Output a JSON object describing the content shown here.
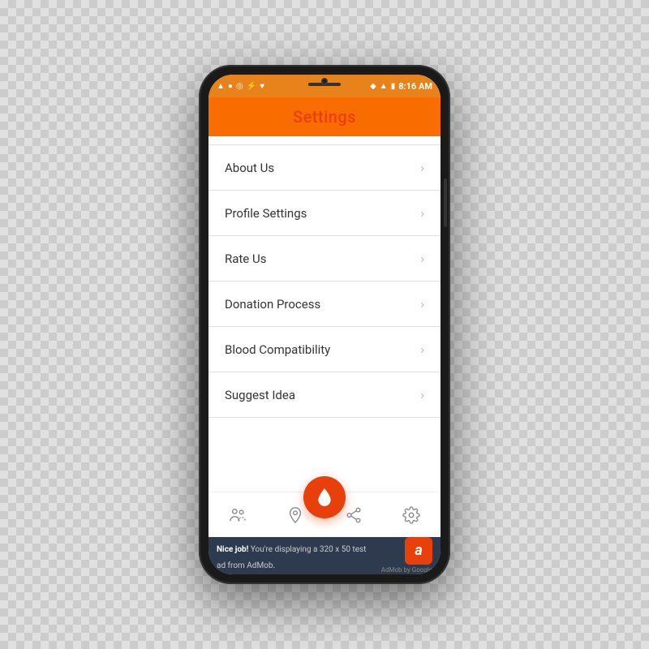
{
  "phone": {
    "status_bar": {
      "time": "8:16 AM",
      "battery": "81%"
    },
    "header": {
      "title": "Settings"
    },
    "menu": {
      "items": [
        {
          "id": "about-us",
          "label": "About Us"
        },
        {
          "id": "profile-settings",
          "label": "Profile Settings"
        },
        {
          "id": "rate-us",
          "label": "Rate Us"
        },
        {
          "id": "donation-process",
          "label": "Donation Process"
        },
        {
          "id": "blood-compatibility",
          "label": "Blood Compatibility"
        },
        {
          "id": "suggest-idea",
          "label": "Suggest Idea"
        }
      ]
    },
    "bottom_nav": {
      "icons": [
        {
          "id": "people-icon",
          "symbol": "♟"
        },
        {
          "id": "location-icon",
          "symbol": "◎"
        },
        {
          "id": "share-icon",
          "symbol": "⋈"
        },
        {
          "id": "settings-icon",
          "symbol": "⚙"
        }
      ]
    },
    "ad": {
      "bold": "Nice job!",
      "text": " You're displaying a 320 x 50 test ad from AdMob.",
      "google_label": "AdMob by Google",
      "logo_letter": "a"
    }
  },
  "colors": {
    "accent": "#f96d00",
    "accent_dark": "#e8400a",
    "header_title": "#e8400a"
  }
}
